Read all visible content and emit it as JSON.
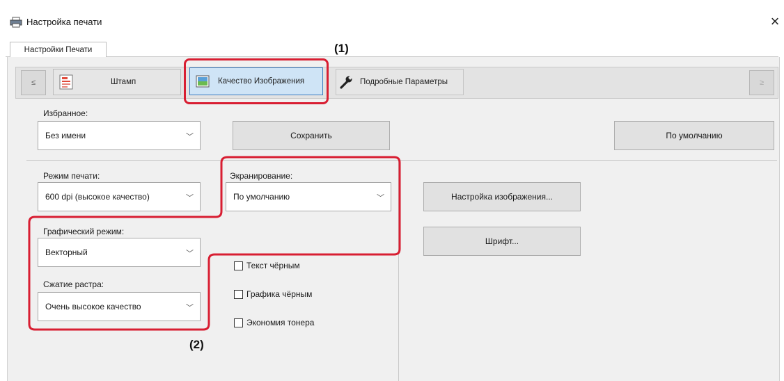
{
  "window": {
    "title": "Настройка печати",
    "close_symbol": "×"
  },
  "tabs": [
    {
      "label": "Настройки Печати",
      "active": true
    }
  ],
  "toolbar": {
    "prev_symbol": "≤",
    "next_symbol": "≥",
    "items": [
      {
        "label": "Штамп",
        "icon": "stamp-icon"
      },
      {
        "label": "Качество Изображения",
        "icon": "image-quality-icon",
        "selected": true
      },
      {
        "label": "Подробные Параметры",
        "icon": "wrench-icon"
      }
    ]
  },
  "favorites": {
    "label": "Избранное:",
    "value": "Без имени",
    "save_label": "Сохранить",
    "default_label": "По умолчанию"
  },
  "print_mode": {
    "label": "Режим печати:",
    "value": "600 dpi (высокое качество)"
  },
  "graphics_mode": {
    "label": "Графический режим:",
    "value": "Векторный"
  },
  "raster_compression": {
    "label": "Сжатие растра:",
    "value": "Очень высокое качество"
  },
  "screening": {
    "label": "Экранирование:",
    "value": "По умолчанию"
  },
  "buttons": {
    "image_settings": "Настройка изображения...",
    "font": "Шрифт..."
  },
  "checkboxes": [
    {
      "label": "Текст чёрным",
      "checked": false
    },
    {
      "label": "Графика чёрным",
      "checked": false
    },
    {
      "label": "Экономия тонера",
      "checked": false
    }
  ],
  "callouts": {
    "one": "(1)",
    "two": "(2)"
  },
  "colors": {
    "highlight_red": "#d81e32",
    "selected_blue": "#cfe4f6"
  }
}
